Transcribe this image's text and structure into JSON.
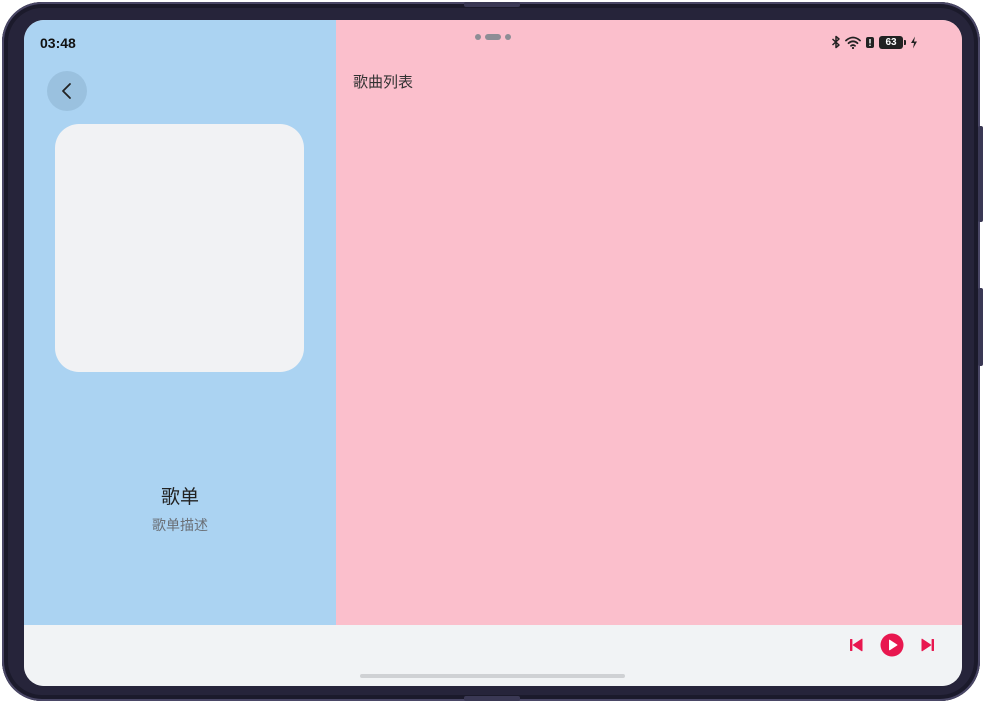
{
  "status_bar": {
    "time": "03:48",
    "battery_level": "63",
    "icons": [
      "bluetooth-icon",
      "wifi-icon",
      "notification-icon",
      "battery-icon",
      "charging-icon"
    ]
  },
  "left_pane": {
    "back_icon": "chevron-left-icon",
    "playlist_title": "歌单",
    "playlist_description": "歌单描述"
  },
  "right_pane": {
    "header": "歌曲列表"
  },
  "player": {
    "controls": [
      "previous-icon",
      "play-icon",
      "next-icon"
    ],
    "accent_color": "#e8174f"
  },
  "colors": {
    "left_pane_bg": "#abd3f2",
    "right_pane_bg": "#fbbfcc",
    "bottom_bar_bg": "#f1f3f5"
  }
}
